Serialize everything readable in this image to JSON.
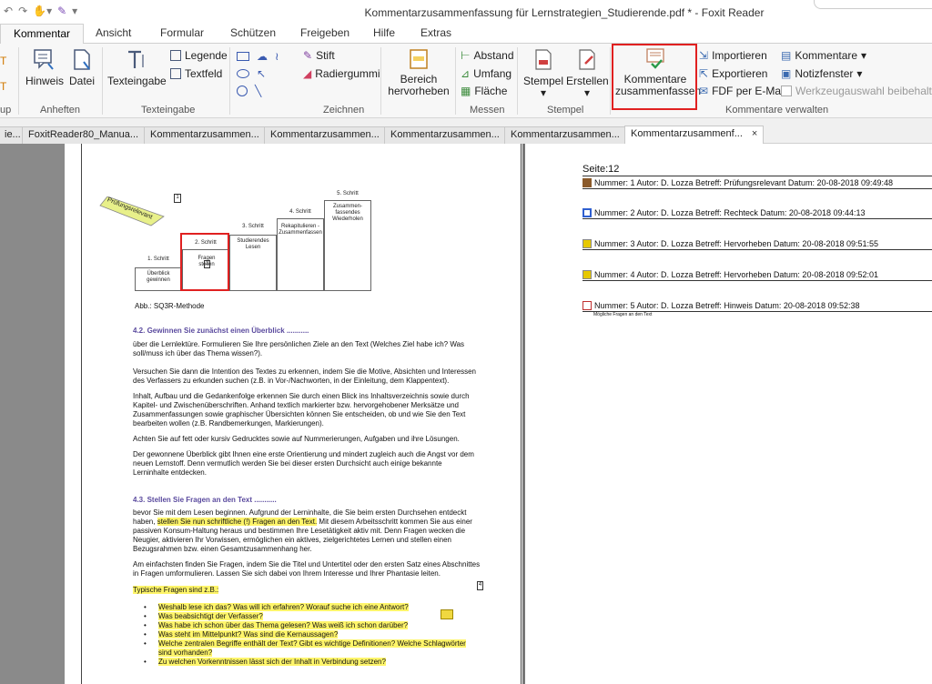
{
  "window": {
    "title": "Kommentarzusammenfassung für Lernstrategien_Studierende.pdf * - Foxit Reader"
  },
  "ribbon_tabs": [
    "Kommentar",
    "Ansicht",
    "Formular",
    "Schützen",
    "Freigeben",
    "Hilfe",
    "Extras"
  ],
  "ribbon": {
    "groups": {
      "up": "up",
      "anheften": "Anheften",
      "texteingabe": "Texteingabe",
      "zeichnen": "Zeichnen",
      "messen": "Messen",
      "stempel": "Stempel",
      "verwalten": "Kommentare verwalten"
    },
    "hinweis": "Hinweis",
    "datei": "Datei",
    "texteingabe": "Texteingabe",
    "legende": "Legende",
    "textfeld": "Textfeld",
    "stift": "Stift",
    "radiergummi": "Radiergummi",
    "bereich_1": "Bereich",
    "bereich_2": "hervorheben",
    "abstand": "Abstand",
    "umfang": "Umfang",
    "flaeche": "Fläche",
    "stempel": "Stempel",
    "erstellen": "Erstellen",
    "summarize_1": "Kommentare",
    "summarize_2": "zusammenfassen",
    "importieren": "Importieren",
    "exportieren": "Exportieren",
    "fdf": "FDF per E-Mail",
    "kommentare": "Kommentare",
    "notizfenster": "Notizfenster",
    "werkzeug": "Werkzeugauswahl beibehalten"
  },
  "doc_tabs": [
    "ie...",
    "FoxitReader80_Manua...",
    "Kommentarzusammen...",
    "Kommentarzusammen...",
    "Kommentarzusammen...",
    "Kommentarzusammen...",
    "Kommentarzusammenf..."
  ],
  "doc_tab_close": "×",
  "page": {
    "diagram": {
      "tag": "Prüfungsrelevant",
      "step1": "1. Schritt",
      "step1_body": "Überblick gewinnen",
      "step2": "2. Schritt",
      "step2_body": "Fragen stellen",
      "step3": "3. Schritt",
      "step3_body": "Studierendes Lesen",
      "step4": "4. Schritt",
      "step4_body": "Rekapitulieren - Zusammenfassen",
      "step5": "5. Schritt",
      "step5_body": "Zusammen-fassendes Wiederholen"
    },
    "caption": "Abb.: SQ3R-Methode",
    "h1": "4.2. Gewinnen Sie zunächst einen Überblick ...........",
    "p1": "über die Lernlektüre. Formulieren Sie Ihre persönlichen Ziele an den Text (Welches Ziel habe ich? Was soll/muss ich über das Thema wissen?).",
    "p2": "Versuchen Sie dann die Intention des Textes zu erkennen, indem Sie die Motive, Absichten und Interessen des Verfassers zu erkunden suchen (z.B. in Vor-/Nachworten, in der Einleitung, dem Klappentext).",
    "p3": "Inhalt, Aufbau und die Gedankenfolge erkennen Sie durch einen Blick ins Inhaltsverzeichnis sowie durch Kapitel- und Zwischenüberschriften. Anhand textlich markierter bzw. hervorgehobener Merksätze und Zusammenfassungen sowie graphischer Übersichten können Sie entscheiden, ob und wie Sie den Text bearbeiten wollen (z.B. Randbemerkungen, Markierungen).",
    "p4": "Achten Sie auf fett oder kursiv Gedrucktes sowie auf Nummerierungen, Aufgaben und ihre Lösungen.",
    "p5": "Der gewonnene Überblick gibt Ihnen eine erste Orientierung und mindert zugleich auch die Angst vor dem neuen Lernstoff. Denn vermutlich werden Sie bei dieser ersten Durchsicht auch einige bekannte Lerninhalte entdecken.",
    "h2": "4.3. Stellen Sie Fragen an den Text ...........",
    "p6a": "bevor Sie mit dem Lesen beginnen. Aufgrund der Lerninhalte, die Sie beim ersten Durchsehen entdeckt haben, ",
    "p6hl": "stellen Sie nun schriftliche (!) Fragen an den Text.",
    "p6b": " Mit diesem Arbeitsschritt kommen Sie aus einer passiven Konsum-Haltung heraus und bestimmen Ihre Lesetätigkeit aktiv mit. Denn Fragen wecken die Neugier, aktivieren Ihr Vorwissen, ermöglichen ein aktives, zielgerichtetes Lernen und stellen einen Bezugsrahmen bzw. einen Gesamtzusammenhang her.",
    "p7": "Am einfachsten finden Sie Fragen, indem Sie die Titel und Untertitel oder den ersten Satz eines Abschnittes in Fragen umformulieren. Lassen Sie sich dabei von Ihrem Interesse und Ihrer Phantasie leiten.",
    "p8": "Typische Fragen sind z.B.:",
    "bullets": [
      "Weshalb lese ich das? Was will ich erfahren? Worauf suche ich eine Antwort?",
      "Was beabsichtigt der Verfasser?",
      "Was habe ich schon über das Thema gelesen? Was weiß ich schon darüber?",
      "Was steht im Mittelpunkt? Was sind die Kernaussagen?",
      "Welche zentralen Begriffe enthält der Text? Gibt es wichtige Definitionen? Welche Schlagwörter sind vorhanden?",
      "Zu welchen Vorkenntnissen lässt sich der Inhalt in Verbindung setzen?"
    ]
  },
  "summary": {
    "page_label": "Seite:12",
    "entries": [
      {
        "text": "Nummer: 1  Autor: D. Lozza  Betreff: Prüfungsrelevant  Datum: 20-08-2018 09:49:48",
        "icon": "stamp-icon",
        "color": "#8b5a2b"
      },
      {
        "text": "Nummer: 2  Autor: D. Lozza  Betreff: Rechteck  Datum: 20-08-2018 09:44:13",
        "icon": "rectangle-icon",
        "color": "#2f5fd0"
      },
      {
        "text": "Nummer: 3  Autor: D. Lozza  Betreff: Hervorheben  Datum: 20-08-2018 09:51:55",
        "icon": "highlight-icon",
        "color": "#e6c800"
      },
      {
        "text": "Nummer: 4  Autor: D. Lozza  Betreff: Hervorheben  Datum: 20-08-2018 09:52:01",
        "icon": "highlight-icon",
        "color": "#e6c800"
      },
      {
        "text": "Nummer: 5  Autor: D. Lozza  Betreff: Hinweis  Datum: 20-08-2018 09:52:38",
        "icon": "note-icon",
        "color": "#c03030"
      }
    ],
    "entry5_note": "Mögliche Fragen an den Text"
  }
}
